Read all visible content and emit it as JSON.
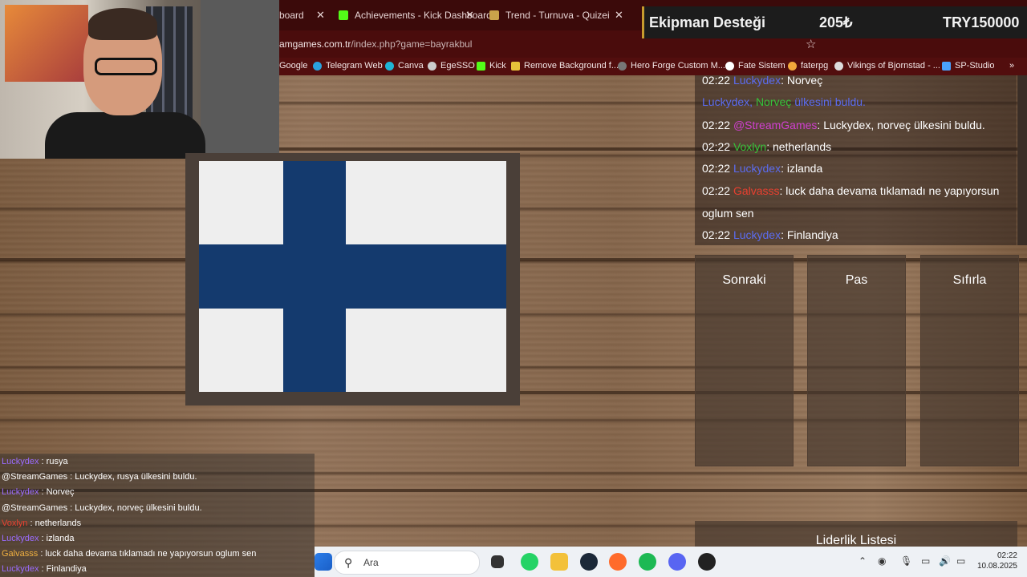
{
  "browser": {
    "tabs": [
      {
        "title": "board",
        "favicon": "kick-icon",
        "color": "#53fc18"
      },
      {
        "title": "Achievements - Kick Dashboard",
        "favicon": "kick-icon",
        "color": "#53fc18"
      },
      {
        "title": "Trend - Turnuva - Quizei",
        "favicon": "quiz-icon",
        "color": "#c9a24a"
      }
    ],
    "url_prefix": "amgames.com.tr",
    "url_suffix": "/index.php?game=bayrakbul",
    "bookmarks": [
      "Google",
      "Telegram Web",
      "Canva",
      "EgeSSO",
      "Kick",
      "Remove Background f...",
      "Hero Forge Custom M...",
      "Fate Sistem",
      "faterpg",
      "Vikings of Bjornstad - ...",
      "SP-Studio"
    ]
  },
  "donation": {
    "label": "Ekipman Desteği",
    "amount": "205₺",
    "goal": "TRY150000"
  },
  "chat": {
    "messages": [
      {
        "time": "02:22",
        "user": "Luckydex",
        "user_color": "#5b6cf0",
        "text": "Norveç"
      },
      {
        "time": "",
        "user": "Luckydex, ",
        "user_color": "#5b6cf0",
        "mention": "Norveç",
        "mention_color": "#36c23a",
        "text": "ülkesini buldu.",
        "text_color": "#5b6cf0"
      },
      {
        "time": "02:22",
        "user": "@StreamGames",
        "user_color": "#d040d0",
        "text": "Luckydex, norveç ülkesini buldu."
      },
      {
        "time": "02:22",
        "user": "Voxlyn",
        "user_color": "#36c23a",
        "text": "netherlands"
      },
      {
        "time": "02:22",
        "user": "Luckydex",
        "user_color": "#5b6cf0",
        "text": "izlanda"
      },
      {
        "time": "02:22",
        "user": "Galvasss",
        "user_color": "#e84030",
        "text": "luck daha devama tıklamadı ne yapıyorsun"
      },
      {
        "time": "",
        "user": "",
        "user_color": "#ffffff",
        "text": "oglum sen"
      },
      {
        "time": "02:22",
        "user": "Luckydex",
        "user_color": "#5b6cf0",
        "text": "Finlandiya"
      }
    ]
  },
  "buttons": {
    "next": "Sonraki",
    "pass": "Pas",
    "reset": "Sıfırla"
  },
  "leaderboard": {
    "title": "Liderlik Listesi"
  },
  "overlay_chat": [
    {
      "user": "Luckydex",
      "color": "#9b6cff",
      "text": ": rusya"
    },
    {
      "user": "@StreamGames",
      "color": "#ffffff",
      "text": ": Luckydex, rusya ülkesini buldu."
    },
    {
      "user": "Luckydex",
      "color": "#9b6cff",
      "text": ": Norveç"
    },
    {
      "user": "@StreamGames",
      "color": "#ffffff",
      "text": ": Luckydex, norveç ülkesini buldu."
    },
    {
      "user": "Voxlyn",
      "color": "#e84030",
      "text": ": netherlands"
    },
    {
      "user": "Luckydex",
      "color": "#9b6cff",
      "text": ": izlanda"
    },
    {
      "user": "Galvasss",
      "color": "#f0b040",
      "text": ": luck daha devama tıklamadı ne yapıyorsun oglum sen"
    },
    {
      "user": "Luckydex",
      "color": "#9b6cff",
      "text": ": Finlandiya"
    }
  ],
  "taskbar": {
    "search_placeholder": "Ara",
    "time": "02:22",
    "date": "10.08.2025"
  },
  "flag": {
    "country_colors": {
      "white": "#eeeeee",
      "blue": "#143a6e"
    }
  }
}
